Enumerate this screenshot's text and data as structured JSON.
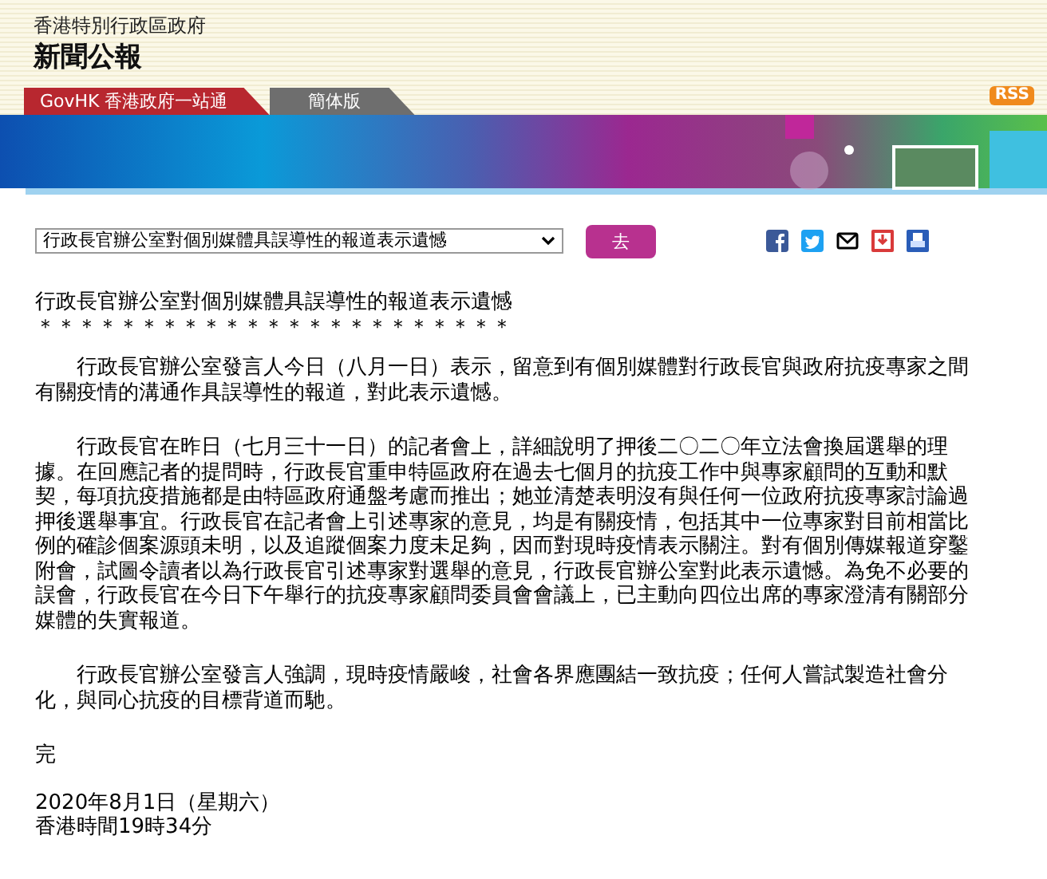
{
  "header": {
    "org": "香港特別行政區政府",
    "title": "新聞公報"
  },
  "nav_tabs": [
    {
      "label": "GovHK 香港政府一站通",
      "color": "#b8272f"
    },
    {
      "label": "簡体版",
      "color": "#6e6e6e"
    }
  ],
  "rss": "RSS",
  "toolbar": {
    "article_select": "行政長官辦公室對個別媒體具誤導性的報道表示遺憾",
    "go_button": "去"
  },
  "article": {
    "title": "行政長官辦公室對個別媒體具誤導性的報道表示遺憾",
    "separator": "＊＊＊＊＊＊＊＊＊＊＊＊＊＊＊＊＊＊＊＊＊＊＊",
    "paragraphs": [
      "行政長官辦公室發言人今日（八月一日）表示，留意到有個別媒體對行政長官與政府抗疫專家之間有關疫情的溝通作具誤導性的報道，對此表示遺憾。",
      "行政長官在昨日（七月三十一日）的記者會上，詳細說明了押後二〇二〇年立法會換屆選舉的理據。在回應記者的提問時，行政長官重申特區政府在過去七個月的抗疫工作中與專家顧問的互動和默契，每項抗疫措施都是由特區政府通盤考慮而推出；她並清楚表明沒有與任何一位政府抗疫專家討論過押後選舉事宜。行政長官在記者會上引述專家的意見，均是有關疫情，包括其中一位專家對目前相當比例的確診個案源頭未明，以及追蹤個案力度未足夠，因而對現時疫情表示關注。對有個別傳媒報道穿鑿附會，試圖令讀者以為行政長官引述專家對選舉的意見，行政長官辦公室對此表示遺憾。為免不必要的誤會，行政長官在今日下午舉行的抗疫專家顧問委員會會議上，已主動向四位出席的專家澄清有關部分媒體的失實報道。",
      "行政長官辦公室發言人強調，現時疫情嚴峻，社會各界應團結一致抗疫；任何人嘗試製造社會分化，與同心抗疫的目標背道而馳。"
    ],
    "end_mark": "完",
    "date": "2020年8月1日（星期六）",
    "time": "香港時間19時34分"
  }
}
